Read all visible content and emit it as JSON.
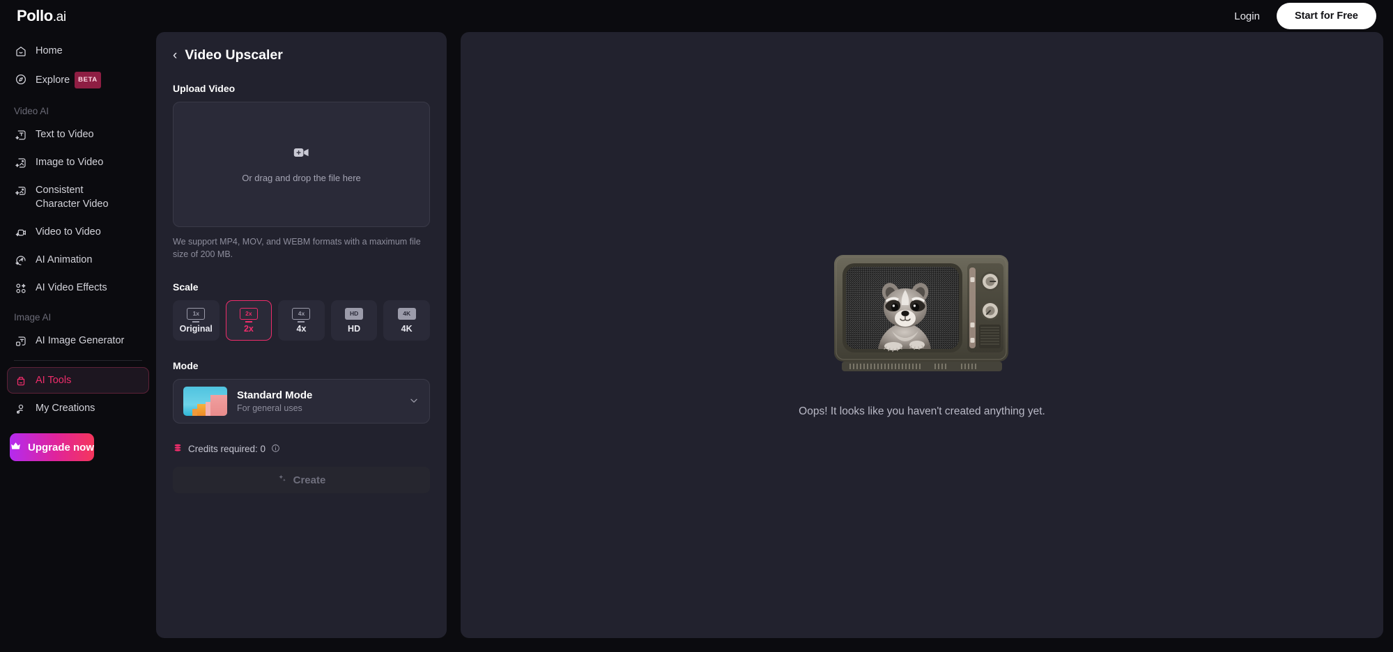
{
  "topbar": {
    "logo_main": "Pollo",
    "logo_suffix": ".ai",
    "login_label": "Login",
    "start_free_label": "Start for Free"
  },
  "sidebar": {
    "items": [
      {
        "label": "Home",
        "icon": "home-icon"
      },
      {
        "label": "Explore",
        "icon": "compass-icon",
        "badge": "BETA"
      }
    ],
    "sections": [
      {
        "label": "Video AI",
        "items": [
          {
            "label": "Text to Video",
            "icon": "text-to-video-icon"
          },
          {
            "label": "Image to Video",
            "icon": "image-to-video-icon"
          },
          {
            "label": "Consistent",
            "label2": "Character Video",
            "icon": "consistent-character-icon"
          },
          {
            "label": "Video to Video",
            "icon": "video-to-video-icon"
          },
          {
            "label": "AI Animation",
            "icon": "ai-animation-icon"
          },
          {
            "label": "AI Video Effects",
            "icon": "ai-video-effects-icon"
          }
        ]
      },
      {
        "label": "Image AI",
        "items": [
          {
            "label": "AI Image Generator",
            "icon": "ai-image-generator-icon"
          }
        ]
      }
    ],
    "bottom_items": [
      {
        "label": "AI Tools",
        "icon": "ai-tools-icon",
        "active": true
      },
      {
        "label": "My Creations",
        "icon": "user-icon",
        "active": false
      }
    ],
    "upgrade_label": "Upgrade now",
    "upgrade_icon": "crown-icon",
    "accent_color": "#ef2d6b"
  },
  "panel": {
    "back_icon": "chevron-left-icon",
    "title": "Video Upscaler",
    "upload": {
      "label": "Upload Video",
      "icon": "video-plus-icon",
      "dropzone_text": "Or drag and drop the file here",
      "note": "We support MP4, MOV, and WEBM formats with a maximum file size of 200 MB."
    },
    "scale": {
      "label": "Scale",
      "selected": "2x",
      "options": [
        {
          "badge": "1x",
          "name": "Original",
          "filled": false
        },
        {
          "badge": "2x",
          "name": "2x",
          "filled": false
        },
        {
          "badge": "4x",
          "name": "4x",
          "filled": false
        },
        {
          "badge": "HD",
          "name": "HD",
          "filled": true
        },
        {
          "badge": "4K",
          "name": "4K",
          "filled": true
        }
      ]
    },
    "mode": {
      "label": "Mode",
      "selected_title": "Standard Mode",
      "selected_desc": "For general uses",
      "chevron_icon": "chevron-down-icon",
      "thumb_icon": "mode-thumbnail"
    },
    "credits": {
      "icon": "coins-icon",
      "text": "Credits required: 0",
      "info_icon": "info-icon"
    },
    "create": {
      "label": "Create",
      "icon": "sparkle-icon",
      "disabled": true
    }
  },
  "main": {
    "illustration": "retro-tv-raccoon-illustration",
    "empty_text": "Oops! It looks like you haven't created anything yet."
  }
}
